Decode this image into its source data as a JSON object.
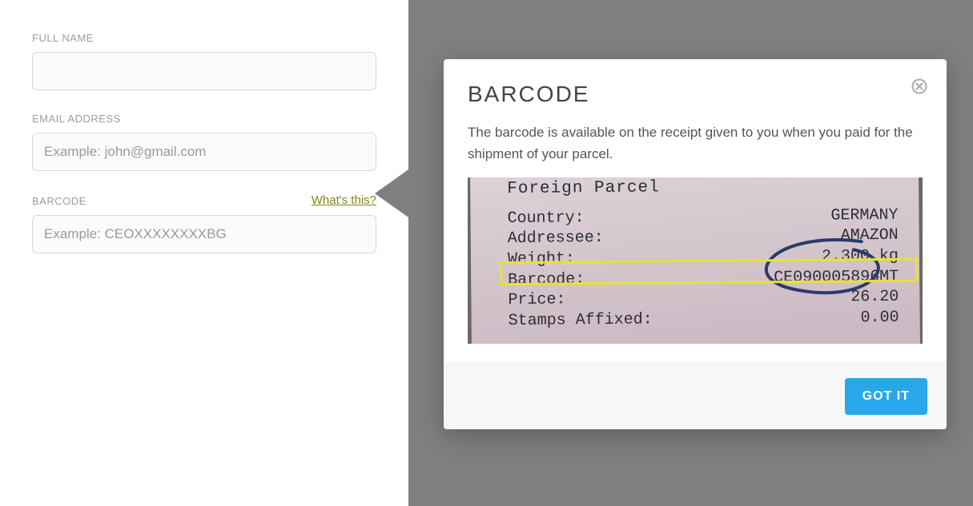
{
  "form": {
    "full_name": {
      "label": "FULL NAME",
      "placeholder": "",
      "value": ""
    },
    "email": {
      "label": "EMAIL ADDRESS",
      "placeholder": "Example: john@gmail.com",
      "value": ""
    },
    "barcode": {
      "label": "BARCODE",
      "placeholder": "Example: CEOXXXXXXXXBG",
      "value": "",
      "help_text": "What's this?"
    }
  },
  "popover": {
    "title": "BARCODE",
    "description": "The barcode is available on the receipt given to you when you paid for the shipment of your parcel.",
    "button_label": "GOT IT"
  },
  "receipt": {
    "heading": "Foreign Parcel",
    "rows": [
      {
        "label": "Country:",
        "value": "GERMANY"
      },
      {
        "label": "Addressee:",
        "value": "AMAZON"
      },
      {
        "label": "Weight:",
        "value": "2.300 kg"
      },
      {
        "label": "Barcode:",
        "value": "CE090005896MT"
      },
      {
        "label": "Price:",
        "value": "26.20"
      },
      {
        "label": "Stamps Affixed:",
        "value": "0.00"
      }
    ]
  },
  "colors": {
    "accent": "#28a8ea",
    "olive_link": "#82821e",
    "highlight": "#e9e233",
    "overlay": "#7f7f7f"
  }
}
